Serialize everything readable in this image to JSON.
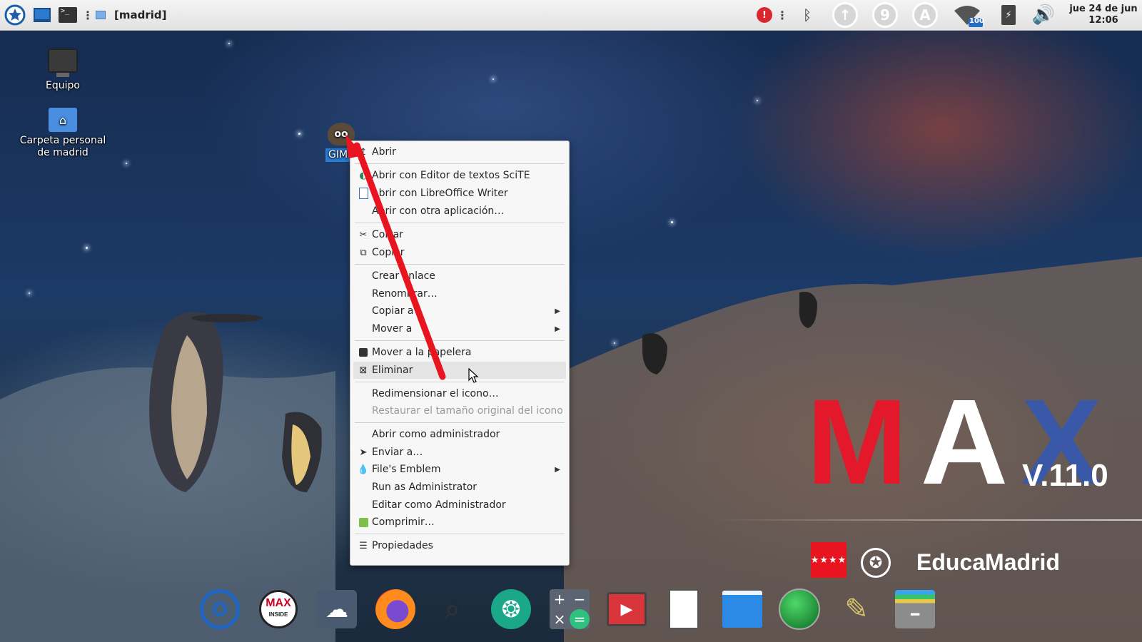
{
  "top_panel": {
    "window_title": "[madrid]",
    "clock": {
      "date": "jue 24 de jun",
      "time": "12:06"
    },
    "wifi_level": "100",
    "icons": [
      "max-menu-icon",
      "show-desktop-icon",
      "terminal-icon",
      "overflow-dots-icon",
      "window-thumb-icon",
      "power-alert-icon",
      "overflow-dots-icon",
      "bluetooth-icon",
      "updates-icon",
      "number-9-icon",
      "keyboard-a-icon",
      "wifi-icon",
      "battery-icon",
      "volume-icon"
    ],
    "badges": {
      "updates": "↑",
      "nine": "9",
      "keyboard": "A"
    }
  },
  "desktop": {
    "icons": [
      {
        "label": "Equipo",
        "icon": "computer-icon"
      },
      {
        "label": "Carpeta personal de madrid",
        "icon": "home-folder-icon"
      },
      {
        "label": "GIM",
        "icon": "gimp-icon"
      }
    ]
  },
  "context_menu": {
    "items": [
      {
        "label": "Abrir",
        "icon": "open-icon"
      },
      {
        "label": "Abrir con Editor de textos SciTE",
        "icon": "scite-icon"
      },
      {
        "label": "Abrir con LibreOffice Writer",
        "icon": "writer-icon"
      },
      {
        "label": "Abrir con otra aplicación…"
      },
      {
        "label": "Cortar",
        "icon": "scissors-icon"
      },
      {
        "label": "Copiar",
        "icon": "copy-icon"
      },
      {
        "label": "Crear enlace"
      },
      {
        "label": "Renombrar…"
      },
      {
        "label": "Copiar a",
        "submenu": true
      },
      {
        "label": "Mover a",
        "submenu": true
      },
      {
        "label": "Mover a la papelera",
        "icon": "trash-icon"
      },
      {
        "label": "Eliminar",
        "icon": "delete-icon",
        "hovered": true
      },
      {
        "label": "Redimensionar el icono…"
      },
      {
        "label": "Restaurar el tamaño original del icono",
        "disabled": true
      },
      {
        "label": "Abrir como administrador"
      },
      {
        "label": "Enviar a…",
        "icon": "send-icon"
      },
      {
        "label": "File's Emblem",
        "icon": "emblem-icon",
        "submenu": true
      },
      {
        "label": "Run as Administrator"
      },
      {
        "label": "Editar como Administrador"
      },
      {
        "label": "Comprimir…",
        "icon": "archive-icon"
      },
      {
        "label": "Propiedades",
        "icon": "properties-icon"
      }
    ]
  },
  "wallpaper": {
    "logo": "MAX",
    "version": "V.11.0",
    "brand": "EducaMadrid",
    "colors": {
      "m": "#e3182a",
      "a": "#ffffff",
      "x": "#3a58a8",
      "accent": "#e8141f"
    }
  },
  "dock": {
    "items": [
      "max-start-icon",
      "max-inside-icon",
      "cloud-icon",
      "firefox-icon",
      "search-icon",
      "aperture-icon",
      "calculator-icon",
      "video-recorder-icon",
      "document-icon",
      "screen-icon",
      "green-sphere-icon",
      "tools-icon",
      "file-cabinet-icon"
    ]
  },
  "annotation": {
    "type": "red-arrow",
    "color": "#e8141f"
  }
}
